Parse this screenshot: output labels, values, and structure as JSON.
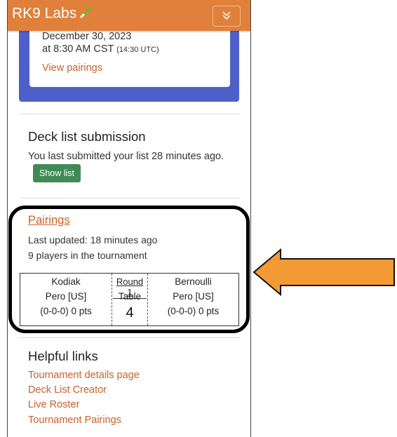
{
  "navbar": {
    "brand": "RK9 Labs",
    "brand_icon": "pencil-icon",
    "toggle_icon": "chevron-down-double-icon"
  },
  "event": {
    "date": "December 30, 2023",
    "time_main": "at 8:30 AM CST",
    "time_utc": "(14:30 UTC)",
    "view_link": "View pairings",
    "accent_color": "#4f5fc9"
  },
  "deck": {
    "title": "Deck list submission",
    "status_text": "You last submitted your list 28 minutes ago.",
    "show_button": "Show list"
  },
  "pairings": {
    "title": "Pairings",
    "last_updated": "Last updated: 18 minutes ago",
    "players": "9 players in the tournament",
    "left": {
      "first": "Kodiak",
      "last": "Pero [US]",
      "record": "(0-0-0) 0 pts"
    },
    "middle": {
      "round": "Round 1",
      "table_label": "Table",
      "table_number": "4"
    },
    "right": {
      "first": "Bernoulli",
      "last": "Pero [US]",
      "record": "(0-0-0) 0 pts"
    }
  },
  "helpful": {
    "title": "Helpful links",
    "links": [
      "Tournament details page",
      "Deck List Creator",
      "Live Roster",
      "Tournament Pairings"
    ]
  },
  "colors": {
    "brand": "#e0803a",
    "link": "#c8622a",
    "button": "#3f8a56",
    "arrow": "#f29a33"
  }
}
